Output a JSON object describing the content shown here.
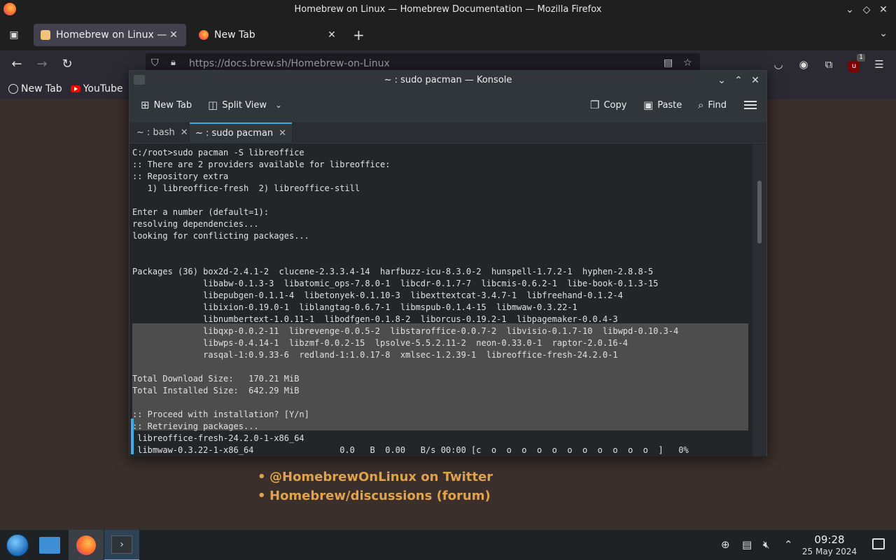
{
  "firefox": {
    "window_title": "Homebrew on Linux — Homebrew Documentation — Mozilla Firefox",
    "tabs": [
      {
        "label": "Homebrew on Linux — H",
        "active": true
      },
      {
        "label": "New Tab",
        "active": false
      }
    ],
    "url_host": "https://docs.brew.sh",
    "url_path": "/Homebrew-on-Linux",
    "extension_badge": "1",
    "bookmarks": [
      {
        "label": "New Tab",
        "icon": "globe-icon"
      },
      {
        "label": "YouTube",
        "icon": "youtube-icon"
      }
    ],
    "page_links": [
      "@HomebrewOnLinux on Twitter",
      "Homebrew/discussions (forum)"
    ],
    "accent_link_color": "#e0a24e"
  },
  "konsole": {
    "window_title": "~ : sudo pacman — Konsole",
    "toolbar": {
      "new_tab": "New Tab",
      "split_view": "Split View",
      "copy": "Copy",
      "paste": "Paste",
      "find": "Find"
    },
    "tabs": [
      {
        "label": "~ : bash",
        "active": false
      },
      {
        "label": "~ : sudo pacman",
        "active": true
      }
    ],
    "terminal_lines": [
      "C:/root>sudo pacman -S libreoffice",
      ":: There are 2 providers available for libreoffice:",
      ":: Repository extra",
      "   1) libreoffice-fresh  2) libreoffice-still",
      "",
      "Enter a number (default=1):",
      "resolving dependencies...",
      "looking for conflicting packages...",
      "",
      "",
      "Packages (36) box2d-2.4.1-2  clucene-2.3.3.4-14  harfbuzz-icu-8.3.0-2  hunspell-1.7.2-1  hyphen-2.8.8-5",
      "              libabw-0.1.3-3  libatomic_ops-7.8.0-1  libcdr-0.1.7-7  libcmis-0.6.2-1  libe-book-0.1.3-15",
      "              libepubgen-0.1.1-4  libetonyek-0.1.10-3  libexttextcat-3.4.7-1  libfreehand-0.1.2-4",
      "              libixion-0.19.0-1  liblangtag-0.6.7-1  libmspub-0.1.4-15  libmwaw-0.3.22-1",
      "              libnumbertext-1.0.11-1  libodfgen-0.1.8-2  liborcus-0.19.2-1  libpagemaker-0.0.4-3",
      "              libqxp-0.0.2-11  librevenge-0.0.5-2  libstaroffice-0.0.7-2  libvisio-0.1.7-10  libwpd-0.10.3-4",
      "              libwps-0.4.14-1  libzmf-0.0.2-15  lpsolve-5.5.2.11-2  neon-0.33.0-1  raptor-2.0.16-4",
      "              rasqal-1:0.9.33-6  redland-1:1.0.17-8  xmlsec-1.2.39-1  libreoffice-fresh-24.2.0-1",
      "",
      "Total Download Size:   170.21 MiB",
      "Total Installed Size:  642.29 MiB",
      "",
      ":: Proceed with installation? [Y/n]",
      ":: Retrieving packages...",
      " libreoffice-fresh-24.2.0-1-x86_64",
      " libmwaw-0.3.22-1-x86_64                 0.0   B  0.00   B/s 00:00 [c  o  o  o  o  o  o  o  o  o  o  o  ]   0%"
    ]
  },
  "taskbar": {
    "time": "09:28",
    "date": "25 May 2024"
  }
}
